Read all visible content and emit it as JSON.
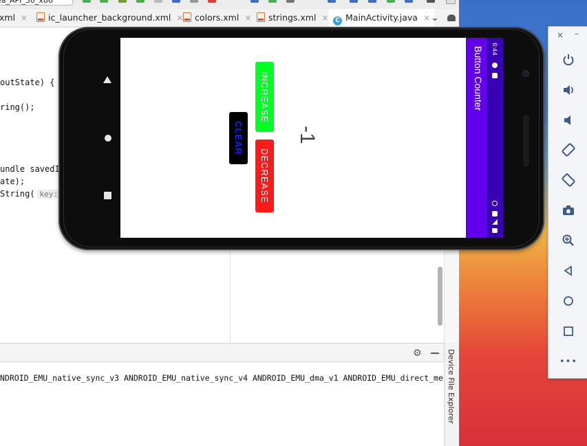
{
  "ide": {
    "device_combo": "ea_API_30_x86",
    "tabs": [
      {
        "label": "xml",
        "close": "×"
      },
      {
        "label": "ic_launcher_background.xml",
        "close": "×"
      },
      {
        "label": "colors.xml",
        "close": "×"
      },
      {
        "label": "strings.xml",
        "close": "×"
      },
      {
        "label": "MainActivity.java",
        "close": "×"
      }
    ],
    "tab_overflow": "⌄",
    "code_lines": {
      "line1": "outState) {",
      "line2": "ring();",
      "line3": "undle savedI",
      "line4": "ate);",
      "line5": "String(",
      "param_hint": "key:"
    },
    "log_text": "NDROID_EMU_native_sync_v3 ANDROID_EMU_native_sync_v4 ANDROID_EMU_dma_v1 ANDROID_EMU_direct_me",
    "device_file_explorer": "Device File Explorer",
    "colors": {
      "accent": "#4a88c7"
    }
  },
  "app": {
    "title": "Button Counter",
    "status_time": "6:44",
    "increase_label": "INCREASE",
    "decrease_label": "DECREASE",
    "clear_label": "CLEAR",
    "counter_value": "-1",
    "colors": {
      "app_bar": "#6200ee",
      "status_bar": "#3700b3",
      "increase": "#00ff22",
      "decrease": "#ff1a1a",
      "clear": "#000000",
      "clear_text": "#1d1dff"
    }
  },
  "emulator_panel": {
    "close": "×",
    "minimize": "–",
    "controls": [
      {
        "name": "power-icon",
        "glyph": "⏻"
      },
      {
        "name": "volume-up-icon",
        "glyph": "🔊"
      },
      {
        "name": "volume-down-icon",
        "glyph": "🔉"
      },
      {
        "name": "rotate-left-icon",
        "glyph": "⟲"
      },
      {
        "name": "rotate-right-icon",
        "glyph": "⟳"
      },
      {
        "name": "camera-icon",
        "glyph": "📷"
      },
      {
        "name": "zoom-icon",
        "glyph": "⊕"
      },
      {
        "name": "back-icon",
        "glyph": "◁"
      },
      {
        "name": "home-icon",
        "glyph": "○"
      },
      {
        "name": "overview-icon",
        "glyph": "□"
      },
      {
        "name": "more-icon",
        "glyph": "•••"
      }
    ]
  }
}
